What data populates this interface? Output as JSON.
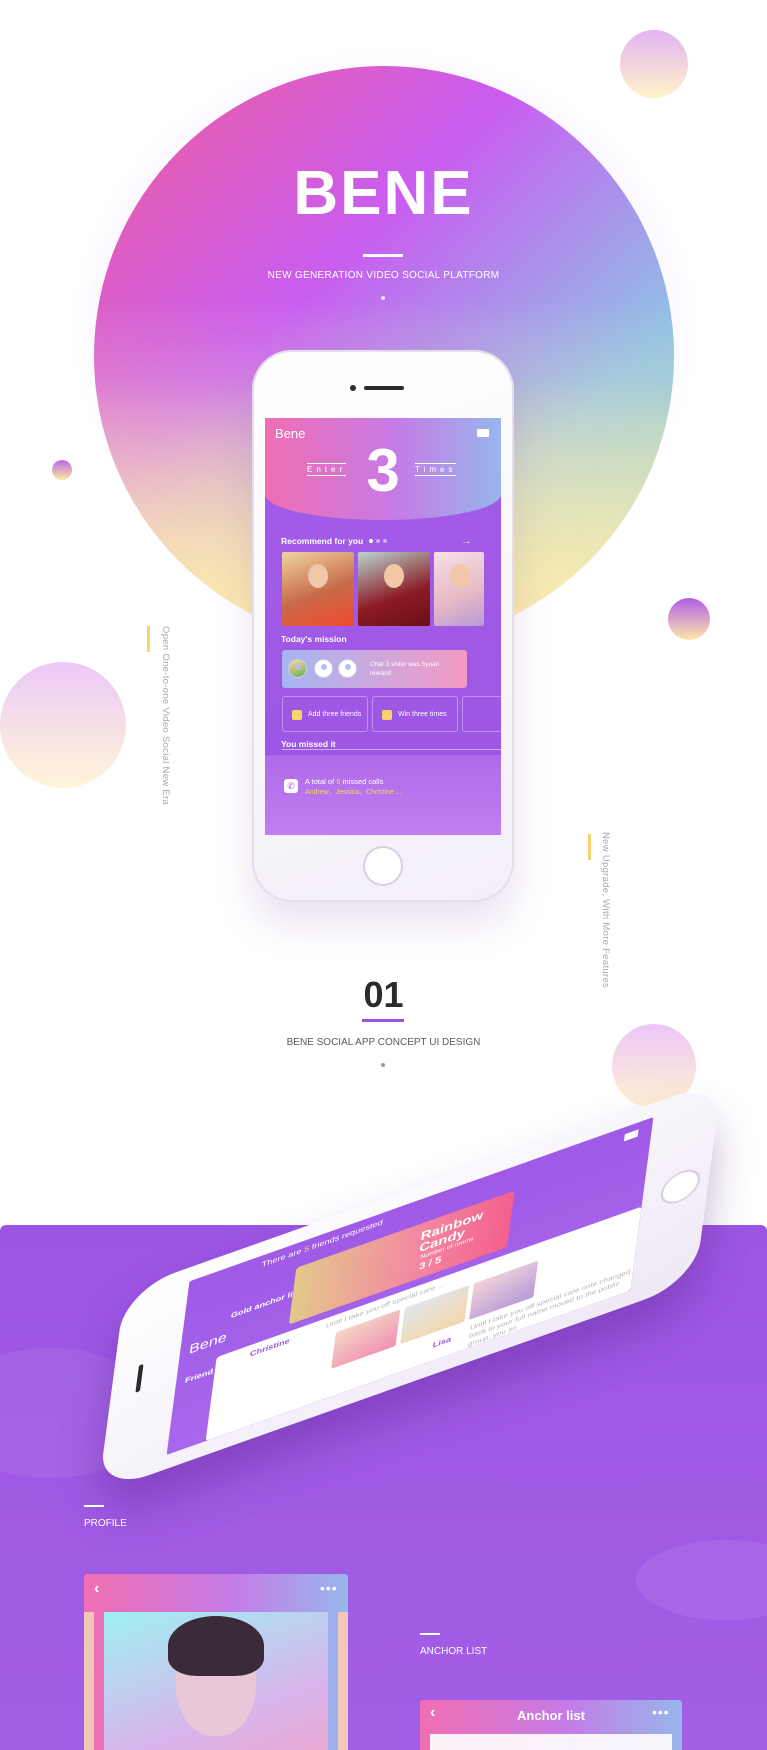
{
  "hero": {
    "title": "BENE",
    "subtitle": "NEW GENERATION VIDEO SOCIAL PLATFORM"
  },
  "side_texts": {
    "left": "Open One-to-one Video Social New Era",
    "right": "New Upgrade, With More Features"
  },
  "phone_screen": {
    "app_name": "Bene",
    "enter_label": "Enter",
    "count": "3",
    "times_label": "Times",
    "recommend_title": "Recommend for you",
    "mission_title": "Today's mission",
    "mission_text": "Chat 3 sister was 5yuan reward!",
    "tasks": [
      "Add three friends",
      "Win three times"
    ],
    "missed_title": "You missed it",
    "missed_prefix": "A total of",
    "missed_count": "5",
    "missed_suffix": "missed calls",
    "missed_names": "Andrew、Jessica、Christine ..."
  },
  "section": {
    "number": "01",
    "title": "BENE SOCIAL APP CONCEPT UI DESIGN"
  },
  "phone2_screen": {
    "app_name": "Bene",
    "friends_prefix": "There are",
    "friends_count": "5",
    "friends_suffix": "friends requested",
    "gold_label": "Gold anchor live",
    "card_title": "Rainbow Candy",
    "rooms_label": "Number of rooms",
    "rooms_value": "3 / 5",
    "updates_label": "Friend updates",
    "user1": "Christine",
    "user1_text": "Until I take you off special care ...",
    "user2": "Lisa",
    "user2_text": "Until I take you off special care note changed back to your full name moved to the public group, you so"
  },
  "labels": {
    "profile": "PROFILE",
    "anchor": "ANCHOR LIST"
  },
  "anchor_card": {
    "title": "Anchor list"
  },
  "colors": {
    "brand_purple": "#9b55e2",
    "accent_yellow": "#f7d46b",
    "pink": "#f16eb2"
  }
}
